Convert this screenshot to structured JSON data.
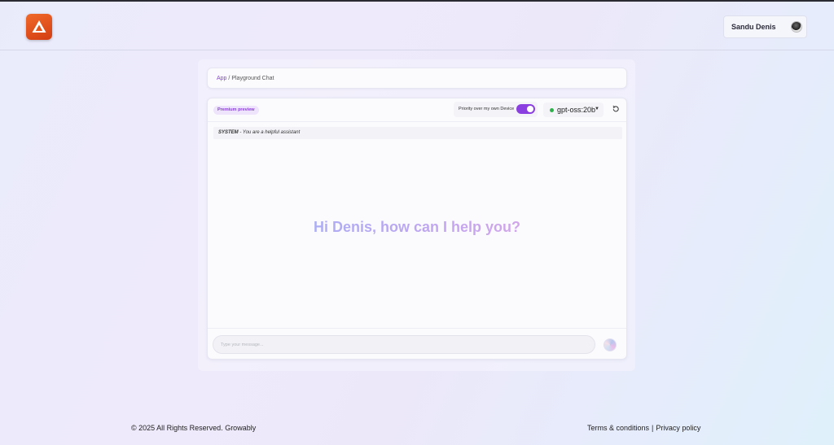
{
  "header": {
    "user_name": "Sandu Denis"
  },
  "breadcrumb": {
    "root": "App",
    "separator": "/",
    "current": "Playground Chat"
  },
  "chat": {
    "badge": "Premium preview",
    "priority_label": "Priority over my own Device",
    "priority_enabled": true,
    "model": {
      "selected": "gpt-oss:20b",
      "status_color": "#2bb34a"
    },
    "system_label": "SYSTEM",
    "system_separator": " - ",
    "system_prompt": "You are a helpful assistant",
    "greeting": "Hi Denis, how can I help you?",
    "input_placeholder": "Type your message..."
  },
  "footer": {
    "copyright": "© 2025 All Rights Reserved. Growably",
    "terms": "Terms & conditions",
    "divider": "|",
    "privacy": "Privacy policy"
  },
  "colors": {
    "accent": "#8b3fe0",
    "logo": "#e4531c"
  }
}
